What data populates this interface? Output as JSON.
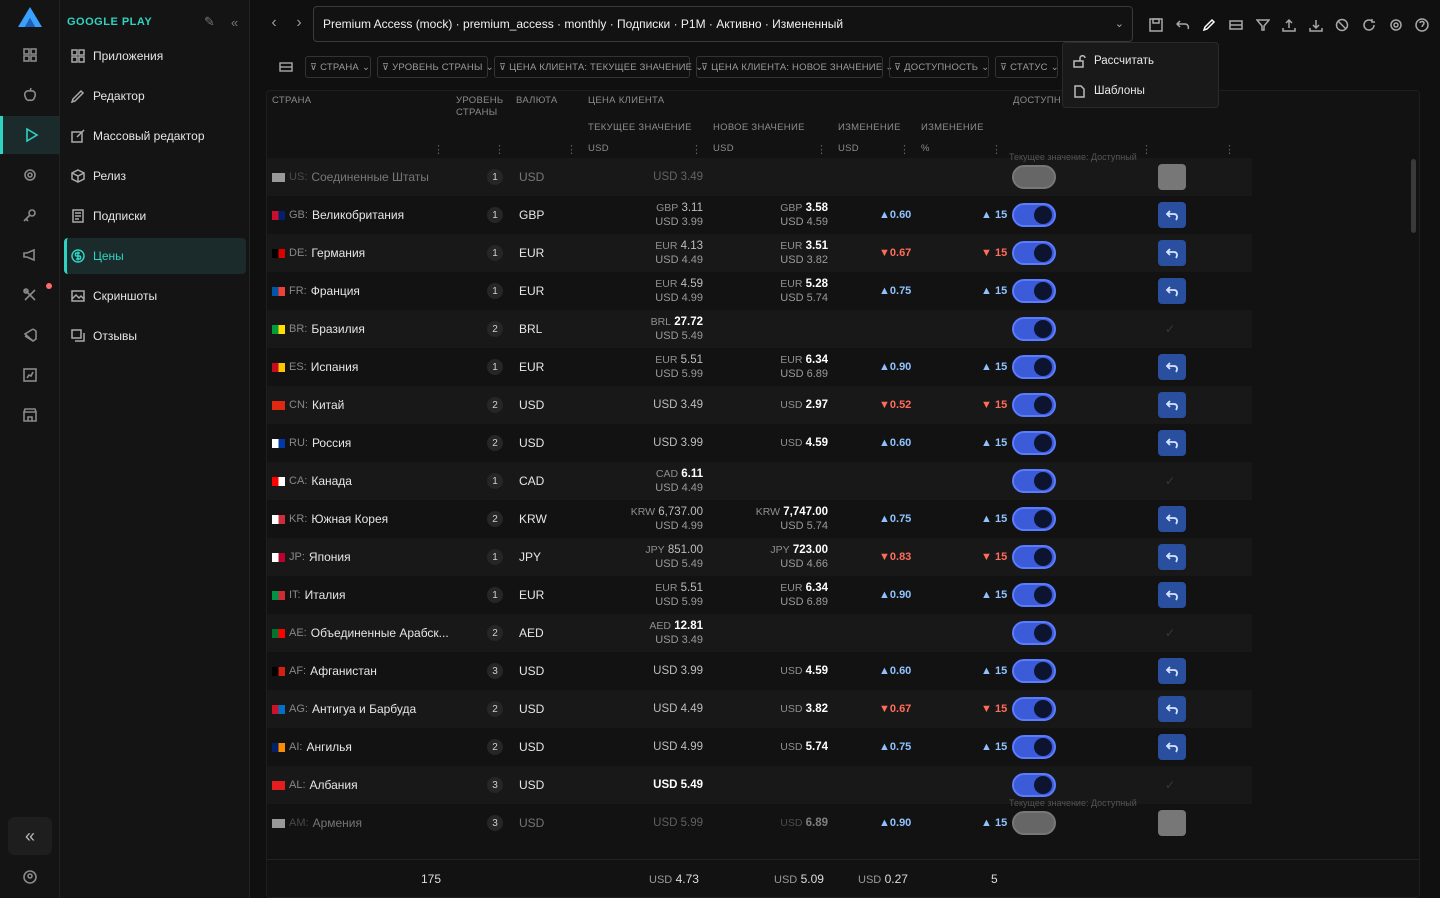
{
  "rail": {
    "collapse_label": "«"
  },
  "menu": {
    "title": "GOOGLE PLAY",
    "items": [
      {
        "label": "Приложения",
        "icon": "apps-icon"
      },
      {
        "label": "Редактор",
        "icon": "pencil-icon"
      },
      {
        "label": "Массовый редактор",
        "icon": "bulk-edit-icon"
      },
      {
        "label": "Релиз",
        "icon": "release-icon"
      },
      {
        "label": "Подписки",
        "icon": "subscriptions-icon"
      },
      {
        "label": "Цены",
        "icon": "dollar-icon",
        "active": true
      },
      {
        "label": "Скриншоты",
        "icon": "image-icon"
      },
      {
        "label": "Отзывы",
        "icon": "reviews-icon"
      }
    ]
  },
  "topbar": {
    "record": "Premium Access (mock) · premium_access · monthly · Подписки · P1M · Активно · Измененный"
  },
  "popover": {
    "calculate": "Рассчитать",
    "templates": "Шаблоны"
  },
  "filters": [
    "СТРАНА",
    "УРОВЕНЬ СТРАНЫ",
    "ЦЕНА КЛИЕНТА: ТЕКУЩЕЕ ЗНАЧЕНИЕ",
    "ЦЕНА КЛИЕНТА: НОВОЕ ЗНАЧЕНИЕ",
    "ДОСТУПНОСТЬ",
    "СТАТУС"
  ],
  "headers": {
    "country": "СТРАНА",
    "tier_l1": "УРОВЕНЬ",
    "tier_l2": "СТРАНЫ",
    "currency": "ВАЛЮТА",
    "client_price": "ЦЕНА КЛИЕНТА",
    "availability": "ДОСТУПН",
    "current": "ТЕКУЩЕЕ ЗНАЧЕНИЕ",
    "new": "НОВОЕ ЗНАЧЕНИЕ",
    "change": "ИЗМЕНЕНИЕ",
    "change_pct": "ИЗМЕНЕНИЕ",
    "cur_unit": "USD",
    "new_unit": "USD",
    "chg_unit": "USD",
    "pct_unit": "%"
  },
  "note_text": "Текущее значение: Доступный",
  "rows": [
    {
      "code": "US:",
      "name": "Соединенные Штаты",
      "tier": "1",
      "cur": "USD",
      "c1u": "",
      "c1": "",
      "c2": "USD 3.49",
      "n1u": "",
      "n1": "",
      "n2": "",
      "chg": "",
      "pct": "",
      "dir": "",
      "toggle": "off",
      "action": "ghost",
      "dim": true,
      "flag": [
        "#999",
        "#999"
      ]
    },
    {
      "code": "GB:",
      "name": "Великобритания",
      "tier": "1",
      "cur": "GBP",
      "c1u": "GBP",
      "c1": "3.11",
      "c2": "USD 3.99",
      "n1u": "GBP",
      "n1": "3.58",
      "n2": "USD 4.59",
      "chg": "0.60",
      "pct": "15",
      "dir": "up",
      "toggle": "on",
      "action": "revert",
      "flag": [
        "#c8102e",
        "#012169"
      ]
    },
    {
      "code": "DE:",
      "name": "Германия",
      "tier": "1",
      "cur": "EUR",
      "c1u": "EUR",
      "c1": "4.13",
      "c2": "USD 4.49",
      "n1u": "EUR",
      "n1": "3.51",
      "n2": "USD 3.82",
      "chg": "0.67",
      "pct": "15",
      "dir": "down",
      "toggle": "on",
      "action": "revert",
      "flag": [
        "#000",
        "#dd0000"
      ]
    },
    {
      "code": "FR:",
      "name": "Франция",
      "tier": "1",
      "cur": "EUR",
      "c1u": "EUR",
      "c1": "4.59",
      "c2": "USD 4.99",
      "n1u": "EUR",
      "n1": "5.28",
      "n2": "USD 5.74",
      "chg": "0.75",
      "pct": "15",
      "dir": "up",
      "toggle": "on",
      "action": "revert",
      "flag": [
        "#0055a4",
        "#ef4135"
      ]
    },
    {
      "code": "BR:",
      "name": "Бразилия",
      "tier": "2",
      "cur": "BRL",
      "c1u": "BRL",
      "c1": "27.72",
      "c2": "USD 5.49",
      "bold_cur": true,
      "n1u": "",
      "n1": "",
      "n2": "",
      "chg": "",
      "pct": "",
      "dir": "",
      "toggle": "on",
      "action": "tick",
      "flag": [
        "#009c3b",
        "#ffdf00"
      ]
    },
    {
      "code": "ES:",
      "name": "Испания",
      "tier": "1",
      "cur": "EUR",
      "c1u": "EUR",
      "c1": "5.51",
      "c2": "USD 5.99",
      "n1u": "EUR",
      "n1": "6.34",
      "n2": "USD 6.89",
      "chg": "0.90",
      "pct": "15",
      "dir": "up",
      "toggle": "on",
      "action": "revert",
      "flag": [
        "#c60b1e",
        "#ffc400"
      ]
    },
    {
      "code": "CN:",
      "name": "Китай",
      "tier": "2",
      "cur": "USD",
      "c1u": "",
      "c1": "",
      "c2": "USD 3.49",
      "n1u": "",
      "n1": "",
      "n2": "USD 2.97",
      "chg": "0.52",
      "pct": "15",
      "dir": "down",
      "toggle": "on",
      "action": "revert",
      "flag": [
        "#de2910",
        "#de2910"
      ]
    },
    {
      "code": "RU:",
      "name": "Россия",
      "tier": "2",
      "cur": "USD",
      "c1u": "",
      "c1": "",
      "c2": "USD 3.99",
      "n1u": "",
      "n1": "",
      "n2": "USD 4.59",
      "chg": "0.60",
      "pct": "15",
      "dir": "up",
      "toggle": "on",
      "action": "revert",
      "flag": [
        "#ffffff",
        "#0039a6"
      ]
    },
    {
      "code": "CA:",
      "name": "Канада",
      "tier": "1",
      "cur": "CAD",
      "c1u": "CAD",
      "c1": "6.11",
      "c2": "USD 4.49",
      "bold_cur": true,
      "n1u": "",
      "n1": "",
      "n2": "",
      "chg": "",
      "pct": "",
      "dir": "",
      "toggle": "on",
      "action": "tick",
      "flag": [
        "#ff0000",
        "#ffffff"
      ]
    },
    {
      "code": "KR:",
      "name": "Южная Корея",
      "tier": "2",
      "cur": "KRW",
      "c1u": "KRW",
      "c1": "6,737.00",
      "c2": "USD 4.99",
      "n1u": "KRW",
      "n1": "7,747.00",
      "n2": "USD 5.74",
      "chg": "0.75",
      "pct": "15",
      "dir": "up",
      "toggle": "on",
      "action": "revert",
      "flag": [
        "#ffffff",
        "#cd2e3a"
      ]
    },
    {
      "code": "JP:",
      "name": "Япония",
      "tier": "1",
      "cur": "JPY",
      "c1u": "JPY",
      "c1": "851.00",
      "c2": "USD 5.49",
      "n1u": "JPY",
      "n1": "723.00",
      "n2": "USD 4.66",
      "chg": "0.83",
      "pct": "15",
      "dir": "down",
      "toggle": "on",
      "action": "revert",
      "flag": [
        "#ffffff",
        "#bc002d"
      ]
    },
    {
      "code": "IT:",
      "name": "Италия",
      "tier": "1",
      "cur": "EUR",
      "c1u": "EUR",
      "c1": "5.51",
      "c2": "USD 5.99",
      "n1u": "EUR",
      "n1": "6.34",
      "n2": "USD 6.89",
      "chg": "0.90",
      "pct": "15",
      "dir": "up",
      "toggle": "on",
      "action": "revert",
      "flag": [
        "#009246",
        "#ce2b37"
      ]
    },
    {
      "code": "AE:",
      "name": "Объединенные Арабск...",
      "tier": "2",
      "cur": "AED",
      "c1u": "AED",
      "c1": "12.81",
      "c2": "USD 3.49",
      "bold_cur": true,
      "n1u": "",
      "n1": "",
      "n2": "",
      "chg": "",
      "pct": "",
      "dir": "",
      "toggle": "on",
      "action": "tick",
      "flag": [
        "#00732f",
        "#ff0000"
      ]
    },
    {
      "code": "AF:",
      "name": "Афганистан",
      "tier": "3",
      "cur": "USD",
      "c1u": "",
      "c1": "",
      "c2": "USD 3.99",
      "n1u": "",
      "n1": "",
      "n2": "USD 4.59",
      "chg": "0.60",
      "pct": "15",
      "dir": "up",
      "toggle": "on",
      "action": "revert",
      "flag": [
        "#000",
        "#d32011"
      ]
    },
    {
      "code": "AG:",
      "name": "Антигуа и Барбуда",
      "tier": "2",
      "cur": "USD",
      "c1u": "",
      "c1": "",
      "c2": "USD 4.49",
      "n1u": "",
      "n1": "",
      "n2": "USD 3.82",
      "chg": "0.67",
      "pct": "15",
      "dir": "down",
      "toggle": "on",
      "action": "revert",
      "flag": [
        "#ce1126",
        "#0072c6"
      ]
    },
    {
      "code": "AI:",
      "name": "Ангилья",
      "tier": "2",
      "cur": "USD",
      "c1u": "",
      "c1": "",
      "c2": "USD 4.99",
      "n1u": "",
      "n1": "",
      "n2": "USD 5.74",
      "chg": "0.75",
      "pct": "15",
      "dir": "up",
      "toggle": "on",
      "action": "revert",
      "flag": [
        "#012169",
        "#ff8c00"
      ]
    },
    {
      "code": "AL:",
      "name": "Албания",
      "tier": "3",
      "cur": "USD",
      "c1u": "",
      "c1": "",
      "c2": "USD 5.49",
      "bold_c2": true,
      "n1u": "",
      "n1": "",
      "n2": "",
      "chg": "",
      "pct": "",
      "dir": "",
      "toggle": "on",
      "action": "tick",
      "flag": [
        "#e41e20",
        "#e41e20"
      ]
    },
    {
      "code": "AM:",
      "name": "Армения",
      "tier": "3",
      "cur": "USD",
      "c1u": "",
      "c1": "",
      "c2": "USD 5.99",
      "n1u": "",
      "n1": "",
      "n2": "USD 6.89",
      "chg": "0.90",
      "pct": "15",
      "dir": "up",
      "toggle": "off",
      "action": "ghost",
      "dim": true,
      "flag": [
        "#999",
        "#999"
      ]
    }
  ],
  "footer": {
    "count": "175",
    "cur_unit": "USD",
    "cur_val": "4.73",
    "new_unit": "USD",
    "new_val": "5.09",
    "chg_unit": "USD",
    "chg_val": "0.27",
    "pct_val": "5"
  },
  "colors": {
    "accent": "#2fd3c2",
    "toggle": "#3b5bd8",
    "up": "#8fc2ff",
    "down": "#ff6d5a"
  }
}
